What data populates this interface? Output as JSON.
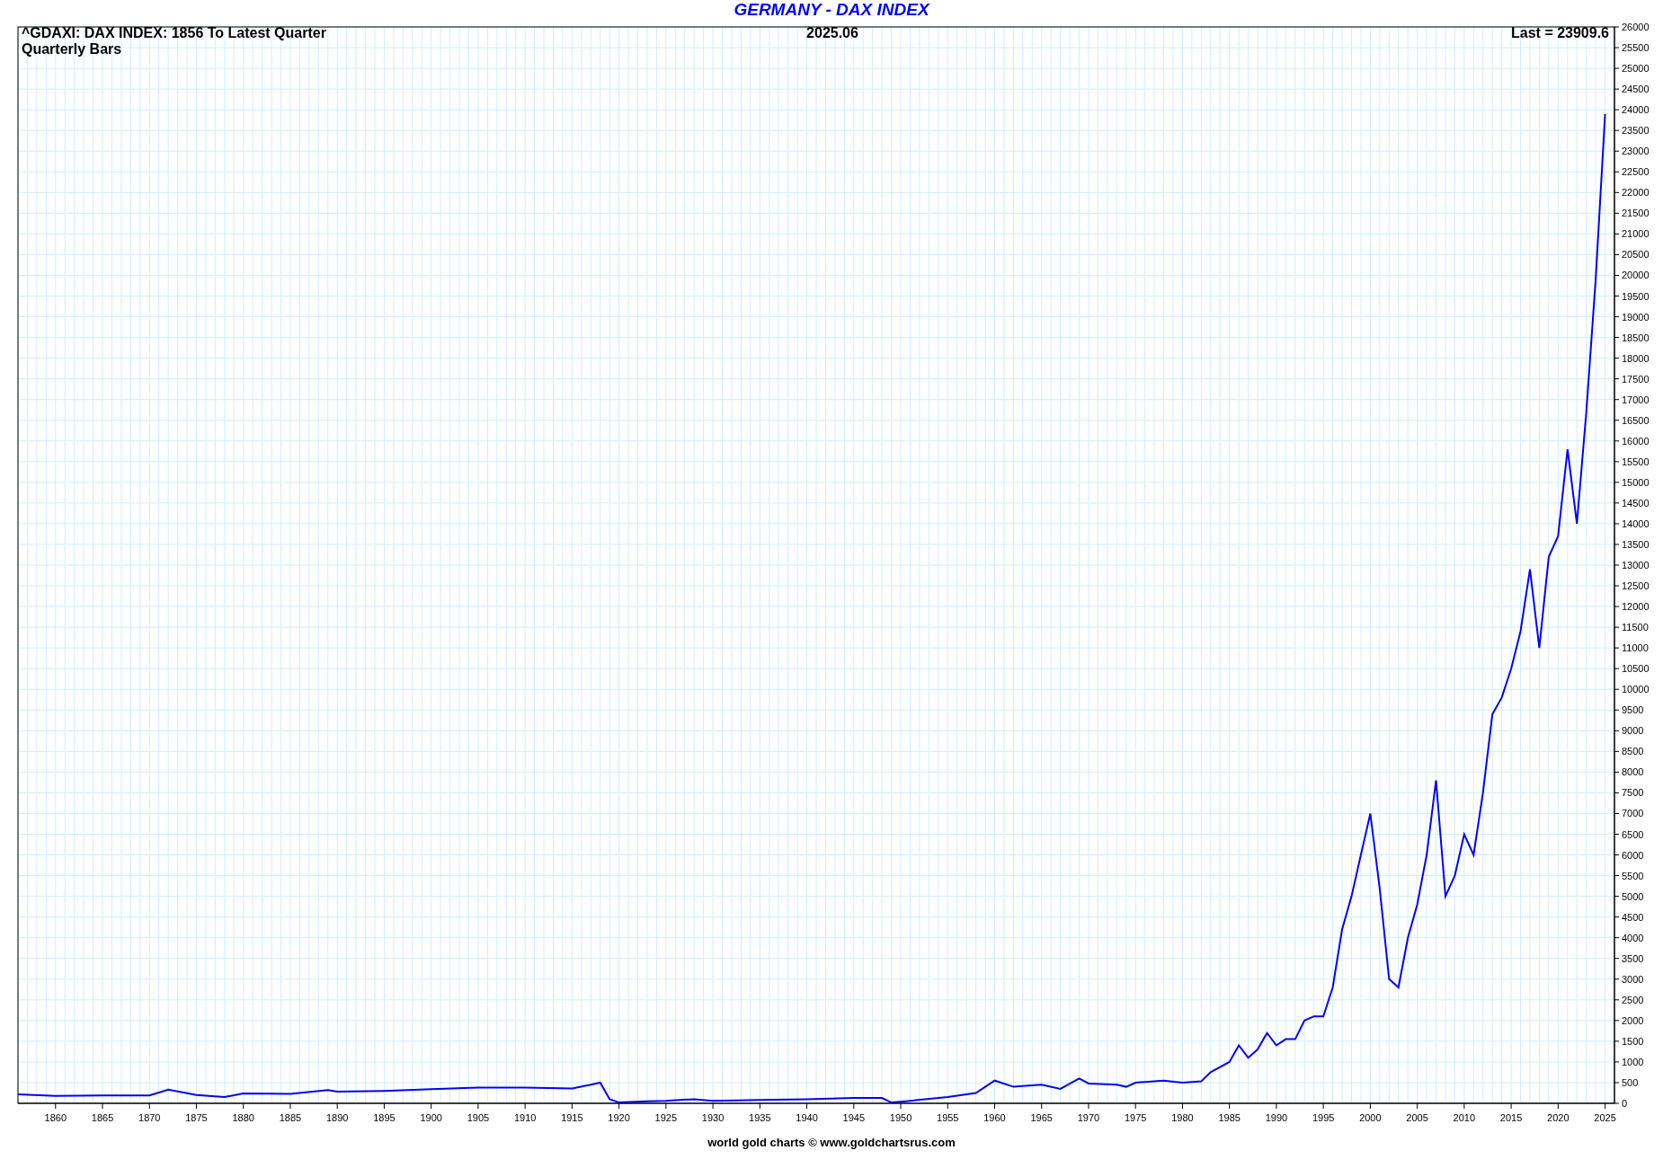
{
  "title": "GERMANY - DAX INDEX",
  "chart": {
    "heading": "^GDAXI: DAX INDEX: 1856 To Latest Quarter",
    "subheading": "Quarterly Bars",
    "date": "2025.06",
    "last": "Last = 23909.6",
    "chart_data": {
      "type": "line",
      "x": [
        1856,
        1860,
        1865,
        1870,
        1872,
        1875,
        1878,
        1880,
        1885,
        1889,
        1890,
        1895,
        1900,
        1905,
        1910,
        1915,
        1917,
        1918,
        1919,
        1920,
        1923,
        1925,
        1928,
        1930,
        1935,
        1940,
        1945,
        1948,
        1949,
        1950,
        1955,
        1958,
        1960,
        1962,
        1965,
        1967,
        1969,
        1970,
        1973,
        1974,
        1975,
        1978,
        1980,
        1982,
        1983,
        1985,
        1986,
        1987,
        1988,
        1989,
        1990,
        1991,
        1992,
        1993,
        1994,
        1995,
        1996,
        1997,
        1998,
        1999,
        2000,
        2001,
        2002,
        2003,
        2004,
        2005,
        2006,
        2007,
        2008,
        2009,
        2010,
        2011,
        2012,
        2013,
        2014,
        2015,
        2016,
        2017,
        2018,
        2019,
        2020,
        2021,
        2022,
        2023,
        2024,
        2025
      ],
      "grid": true,
      "series": [
        {
          "color": "#0000ff",
          "values": [
            220,
            180,
            190,
            190,
            330,
            200,
            150,
            240,
            230,
            320,
            280,
            300,
            340,
            380,
            380,
            360,
            450,
            500,
            100,
            20,
            50,
            60,
            100,
            60,
            80,
            100,
            130,
            130,
            20,
            40,
            150,
            250,
            550,
            400,
            450,
            350,
            600,
            480,
            450,
            400,
            500,
            550,
            500,
            530,
            750,
            1000,
            1400,
            1100,
            1300,
            1700,
            1400,
            1550,
            1550,
            2000,
            2100,
            2100,
            2800,
            4200,
            5000,
            6000,
            7000,
            5200,
            3000,
            2800,
            4000,
            4800,
            6000,
            7800,
            5000,
            5500,
            6500,
            6000,
            7500,
            9400,
            9800,
            10500,
            11400,
            12900,
            11000,
            13200,
            13700,
            15800,
            14000,
            16700,
            19900,
            23900
          ]
        }
      ],
      "xlim": [
        1856,
        2026
      ],
      "ylim": [
        0,
        26000
      ],
      "xticks": [
        1860,
        1865,
        1870,
        1875,
        1880,
        1885,
        1890,
        1895,
        1900,
        1905,
        1910,
        1915,
        1920,
        1925,
        1930,
        1935,
        1940,
        1945,
        1950,
        1955,
        1960,
        1965,
        1970,
        1975,
        1980,
        1985,
        1990,
        1995,
        2000,
        2005,
        2010,
        2015,
        2020,
        2025
      ],
      "yticks": [
        0,
        500,
        1000,
        1500,
        2000,
        2500,
        3000,
        3500,
        4000,
        4500,
        5000,
        5500,
        6000,
        6500,
        7000,
        7500,
        8000,
        8500,
        9000,
        9500,
        10000,
        10500,
        11000,
        11500,
        12000,
        12500,
        13000,
        13500,
        14000,
        14500,
        15000,
        15500,
        16000,
        16500,
        17000,
        17500,
        18000,
        18500,
        19000,
        19500,
        20000,
        20500,
        21000,
        21500,
        22000,
        22500,
        23000,
        23500,
        24000,
        24500,
        25000,
        25500,
        26000
      ]
    }
  },
  "footer": "world gold charts © www.goldchartsrus.com"
}
